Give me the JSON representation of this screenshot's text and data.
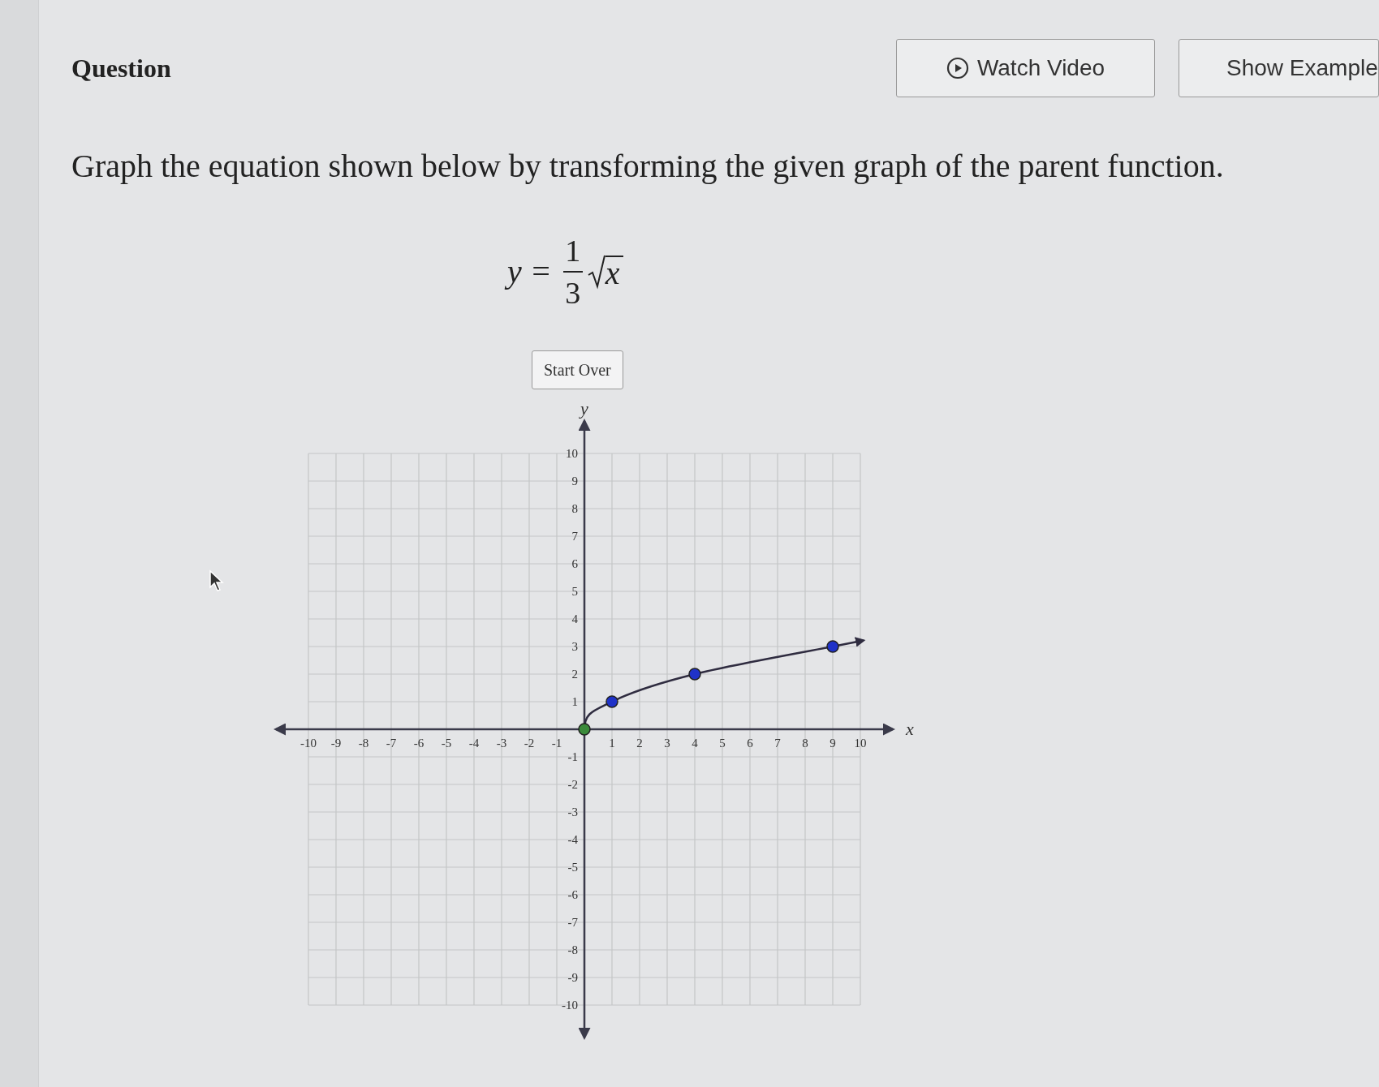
{
  "header": {
    "title": "Question",
    "buttons": [
      {
        "kind": "video",
        "label": "Watch Video"
      },
      {
        "kind": "plain",
        "label": "Show Example"
      }
    ]
  },
  "prompt": "Graph the equation shown below by transforming the given graph of the parent function.",
  "equation": {
    "lhs": "y =",
    "numerator": "1",
    "denominator": "3",
    "radicand": "x"
  },
  "start_over": "Start Over",
  "chart_data": {
    "type": "line",
    "xlabel": "x",
    "ylabel": "y",
    "xlim": [
      -10,
      10
    ],
    "ylim": [
      -10,
      10
    ],
    "xticks": [
      -10,
      -9,
      -8,
      -7,
      -6,
      -5,
      -4,
      -3,
      -2,
      -1,
      1,
      2,
      3,
      4,
      5,
      6,
      7,
      8,
      9,
      10
    ],
    "yticks": [
      -10,
      -9,
      -8,
      -7,
      -6,
      -5,
      -4,
      -3,
      -2,
      -1,
      1,
      2,
      3,
      4,
      5,
      6,
      7,
      8,
      9,
      10
    ],
    "x": [
      0,
      1,
      4,
      9
    ],
    "grid": true,
    "series": [
      {
        "color": "#2f2c40",
        "marker": true,
        "values": [
          0,
          1,
          2,
          3
        ]
      }
    ]
  },
  "plotted_points": [
    {
      "color": "#3a8a3a"
    },
    {
      "color": "#1f32c8"
    },
    {
      "color": "#1f32c8"
    },
    {
      "color": "#1f32c8"
    }
  ]
}
